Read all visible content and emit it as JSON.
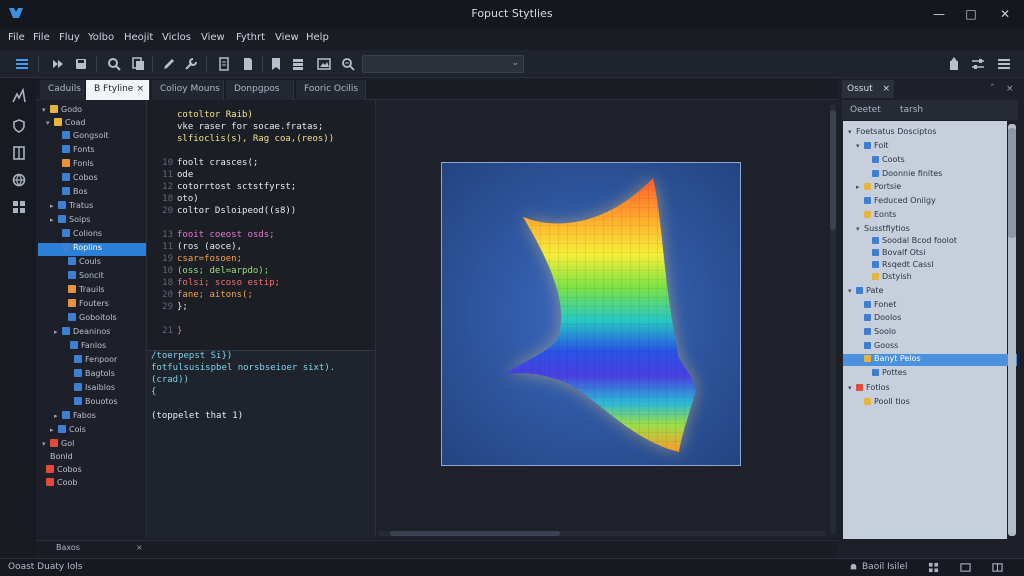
{
  "window": {
    "title": "Fopuct Stytlies"
  },
  "menu": [
    "File",
    "File",
    "Fluy",
    "Yolbo",
    "Heojit",
    "Viclos",
    "View",
    "Fythrt",
    "View",
    "Help"
  ],
  "tabs": [
    {
      "label": "Caduils",
      "active": false
    },
    {
      "label": "B Ftyline",
      "active": true,
      "close": "×"
    },
    {
      "label": "Colioy Mouns",
      "active": false
    },
    {
      "label": "Donpgpos",
      "active": false
    },
    {
      "label": "Fooric Ocilis",
      "active": false
    }
  ],
  "explorer": {
    "items": [
      {
        "chev": "▾",
        "label": "Godo",
        "color": "#e7b53d"
      },
      {
        "chev": "▾",
        "label": "Coad",
        "color": "#e7b53d"
      },
      {
        "chev": "",
        "label": "Gongsoit",
        "color": "#3f7fd3"
      },
      {
        "chev": "",
        "label": "Fonts",
        "color": "#3f7fd3"
      },
      {
        "chev": "",
        "label": "Fonls",
        "color": "#e7933d"
      },
      {
        "chev": "",
        "label": "Cobos",
        "color": "#3f7fd3"
      },
      {
        "chev": "",
        "label": "Bos",
        "color": "#3f7fd3"
      },
      {
        "chev": "▸",
        "label": "Tratus",
        "color": "#3f7fd3"
      },
      {
        "chev": "▸",
        "label": "Soips",
        "color": "#3f7fd3"
      },
      {
        "chev": "",
        "label": "Colions",
        "color": "#3f7fd3"
      },
      {
        "chev": "",
        "label": "Roplins",
        "color": "#3f7fd3",
        "selected": true
      },
      {
        "chev": "",
        "label": "Couls",
        "color": "#3f7fd3"
      },
      {
        "chev": "",
        "label": "Soncit",
        "color": "#3f7fd3"
      },
      {
        "chev": "",
        "label": "Trauils",
        "color": "#e7933d"
      },
      {
        "chev": "",
        "label": "Fouters",
        "color": "#e7933d"
      },
      {
        "chev": "",
        "label": "Goboitols",
        "color": "#3f7fd3"
      },
      {
        "chev": "▸",
        "label": "Deaninos",
        "color": "#3f7fd3"
      },
      {
        "chev": "",
        "label": "Fanlos",
        "color": "#3f7fd3"
      },
      {
        "chev": "",
        "label": "Fenpoor",
        "color": "#3f7fd3"
      },
      {
        "chev": "",
        "label": "Bagtols",
        "color": "#3f7fd3"
      },
      {
        "chev": "",
        "label": "Isaiblos",
        "color": "#3f7fd3"
      },
      {
        "chev": "",
        "label": "Bouotos",
        "color": "#3f7fd3"
      },
      {
        "chev": "▸",
        "label": "Fabos",
        "color": "#3f7fd3"
      },
      {
        "chev": "▸",
        "label": "Cois",
        "color": "#3f7fd3"
      },
      {
        "chev": "▾",
        "label": "Gol",
        "color": "#e24a3d"
      },
      {
        "chev": "",
        "label": "Bonld",
        "color": ""
      },
      {
        "chev": "",
        "label": "Cobos",
        "color": "#e24a3d"
      },
      {
        "chev": "",
        "label": "Coob",
        "color": "#e24a3d"
      }
    ],
    "footer_tab": "Baxos",
    "footer_close": "×"
  },
  "code": [
    {
      "ln": "",
      "text": "cotoltor Raib)",
      "color": "c-yellow"
    },
    {
      "ln": "",
      "text": "vke raser for socae.fratas;",
      "color": "c-white"
    },
    {
      "ln": "",
      "text": "slfioclis(s), Rag coa,(reos))",
      "color": "c-yellow"
    },
    {
      "ln": "",
      "text": "",
      "color": "c-white"
    },
    {
      "ln": "10",
      "text": "foolt crasces(;",
      "color": "c-white"
    },
    {
      "ln": "11",
      "text": "  ode",
      "color": "c-white"
    },
    {
      "ln": "12",
      "text": "   cotorrtost sctstfyrst;",
      "color": "c-white"
    },
    {
      "ln": "18",
      "text": "  oto)",
      "color": "c-white"
    },
    {
      "ln": "20",
      "text": "  coltor Dsloipeod((s8))",
      "color": "c-white"
    },
    {
      "ln": "",
      "text": "",
      "color": "c-white"
    },
    {
      "ln": "13",
      "text": "  fooit coeost osds;",
      "color": "c-magenta"
    },
    {
      "ln": "11",
      "text": "   (ros (aoce),",
      "color": "c-white"
    },
    {
      "ln": "19",
      "text": "   csar=fosoen;",
      "color": "c-orange"
    },
    {
      "ln": "10",
      "text": "   (oss; del=arpdo);",
      "color": "c-green"
    },
    {
      "ln": "18",
      "text": "   folsi; scoso estip;",
      "color": "c-red"
    },
    {
      "ln": "20",
      "text": "   fane; aitons(;",
      "color": "c-orange"
    },
    {
      "ln": "29",
      "text": "  };",
      "color": "c-white"
    },
    {
      "ln": "",
      "text": "",
      "color": "c-white"
    },
    {
      "ln": "21",
      "text": "}",
      "color": "c-red"
    }
  ],
  "console": [
    {
      "text": "/toerpepst Si})",
      "color": "c-cyan"
    },
    {
      "text": "fotfulsusispbel norsbseioer sixt).",
      "color": "c-cyan"
    },
    {
      "text": "  (crad))",
      "color": "c-cyan"
    },
    {
      "text": "{",
      "color": "c-cyan"
    },
    {
      "text": "",
      "color": "c-white"
    },
    {
      "text": "(toppelet that 1)",
      "color": "c-white"
    }
  ],
  "right_panel": {
    "tab": "Ossut",
    "tab_close": "×",
    "subtabs": [
      "Oeetet",
      "tarsh"
    ],
    "outline": [
      {
        "chev": "▾",
        "label": "Foetsatus Dosciptos",
        "color": "",
        "indent": 0
      },
      {
        "chev": "▾",
        "label": "Folt",
        "color": "#3f7fd3",
        "indent": 1
      },
      {
        "chev": "",
        "label": "Coots",
        "color": "#3f7fd3",
        "indent": 2
      },
      {
        "chev": "",
        "label": "Doonnie finites",
        "color": "#3f7fd3",
        "indent": 2
      },
      {
        "chev": "▸",
        "label": "Portsie",
        "color": "#e7b53d",
        "indent": 1
      },
      {
        "chev": "",
        "label": "Feduced Onilgy",
        "color": "#3f7fd3",
        "indent": 1
      },
      {
        "chev": "",
        "label": "Eonts",
        "color": "#e7b53d",
        "indent": 1
      },
      {
        "chev": "▾",
        "label": "Susstfiytios",
        "color": "",
        "indent": 1
      },
      {
        "chev": "",
        "label": "Soodal Bcod foolot",
        "color": "#3f7fd3",
        "indent": 2
      },
      {
        "chev": "",
        "label": "Bovalf Otsi",
        "color": "#3f7fd3",
        "indent": 2
      },
      {
        "chev": "",
        "label": "Rsqedt Cassl",
        "color": "#3f7fd3",
        "indent": 2
      },
      {
        "chev": "",
        "label": "Dstyish",
        "color": "#e7b53d",
        "indent": 2
      },
      {
        "chev": "▾",
        "label": "Pate",
        "color": "#3f7fd3",
        "indent": 0
      },
      {
        "chev": "",
        "label": "Fonet",
        "color": "#3f7fd3",
        "indent": 1
      },
      {
        "chev": "",
        "label": "Doolos",
        "color": "#3f7fd3",
        "indent": 1
      },
      {
        "chev": "",
        "label": "Soolo",
        "color": "#3f7fd3",
        "indent": 1
      },
      {
        "chev": "",
        "label": "Gooss",
        "color": "#3f7fd3",
        "indent": 1
      },
      {
        "chev": "",
        "label": "Banyt Pelos",
        "color": "#e7b53d",
        "indent": 1,
        "selected": true
      },
      {
        "chev": "",
        "label": "Pottes",
        "color": "#3f7fd3",
        "indent": 2
      },
      {
        "chev": "▾",
        "label": "Fotlos",
        "color": "#e24a3d",
        "indent": 0
      },
      {
        "chev": "",
        "label": "Pooll tlos",
        "color": "#e7b53d",
        "indent": 1
      }
    ]
  },
  "status": {
    "left": "Ooast Duaty Iols",
    "right": "Baoil Isilel",
    "icons": [
      "bell-icon",
      "grid-icon",
      "layout-icon",
      "split-icon"
    ]
  },
  "colors": {
    "accent": "#2c7fd6",
    "background": "#1b1e26",
    "plot_bg": "#2f5aa6"
  }
}
